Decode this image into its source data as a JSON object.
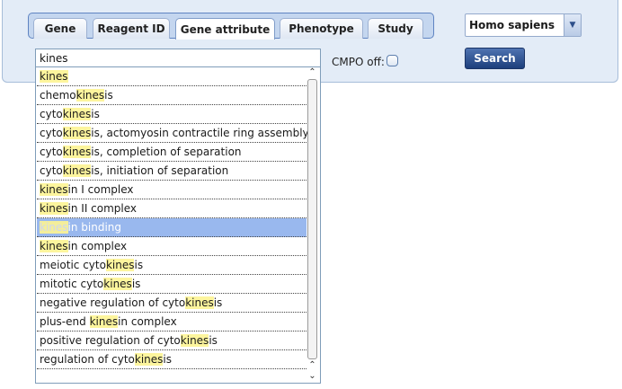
{
  "tabs": [
    {
      "label": "Gene",
      "active": false
    },
    {
      "label": "Reagent ID",
      "active": false
    },
    {
      "label": "Gene attribute",
      "active": true
    },
    {
      "label": "Phenotype",
      "active": false
    },
    {
      "label": "Study",
      "active": false
    }
  ],
  "search": {
    "value": "kines"
  },
  "suggestions": [
    {
      "parts": [
        {
          "t": "kines",
          "h": true
        }
      ]
    },
    {
      "parts": [
        {
          "t": "chemo",
          "h": false
        },
        {
          "t": "kines",
          "h": true
        },
        {
          "t": "is",
          "h": false
        }
      ]
    },
    {
      "parts": [
        {
          "t": "cyto",
          "h": false
        },
        {
          "t": "kines",
          "h": true
        },
        {
          "t": "is",
          "h": false
        }
      ]
    },
    {
      "parts": [
        {
          "t": "cyto",
          "h": false
        },
        {
          "t": "kines",
          "h": true
        },
        {
          "t": "is, actomyosin contractile ring assembly",
          "h": false
        }
      ]
    },
    {
      "parts": [
        {
          "t": "cyto",
          "h": false
        },
        {
          "t": "kines",
          "h": true
        },
        {
          "t": "is, completion of separation",
          "h": false
        }
      ]
    },
    {
      "parts": [
        {
          "t": "cyto",
          "h": false
        },
        {
          "t": "kines",
          "h": true
        },
        {
          "t": "is, initiation of separation",
          "h": false
        }
      ]
    },
    {
      "parts": [
        {
          "t": "kines",
          "h": true
        },
        {
          "t": "in I complex",
          "h": false
        }
      ]
    },
    {
      "parts": [
        {
          "t": "kines",
          "h": true
        },
        {
          "t": "in II complex",
          "h": false
        }
      ]
    },
    {
      "parts": [
        {
          "t": "kines",
          "h": true
        },
        {
          "t": "in binding",
          "h": false
        }
      ],
      "selected": true
    },
    {
      "parts": [
        {
          "t": "kines",
          "h": true
        },
        {
          "t": "in complex",
          "h": false
        }
      ]
    },
    {
      "parts": [
        {
          "t": "meiotic cyto",
          "h": false
        },
        {
          "t": "kines",
          "h": true
        },
        {
          "t": "is",
          "h": false
        }
      ]
    },
    {
      "parts": [
        {
          "t": "mitotic cyto",
          "h": false
        },
        {
          "t": "kines",
          "h": true
        },
        {
          "t": "is",
          "h": false
        }
      ]
    },
    {
      "parts": [
        {
          "t": "negative regulation of cyto",
          "h": false
        },
        {
          "t": "kines",
          "h": true
        },
        {
          "t": "is",
          "h": false
        }
      ]
    },
    {
      "parts": [
        {
          "t": "plus-end ",
          "h": false
        },
        {
          "t": "kines",
          "h": true
        },
        {
          "t": "in complex",
          "h": false
        }
      ]
    },
    {
      "parts": [
        {
          "t": "positive regulation of cyto",
          "h": false
        },
        {
          "t": "kines",
          "h": true
        },
        {
          "t": "is",
          "h": false
        }
      ]
    },
    {
      "parts": [
        {
          "t": "regulation of cyto",
          "h": false
        },
        {
          "t": "kines",
          "h": true
        },
        {
          "t": "is",
          "h": false
        }
      ]
    }
  ],
  "cmpo": {
    "label": "CMPO off:",
    "checked": false
  },
  "species": {
    "value": "Homo sapiens",
    "arrow_icon": "chevron-down-icon"
  },
  "search_button": {
    "label": "Search"
  },
  "colors": {
    "accent": "#1d3f7c",
    "highlight": "#fdf59d",
    "selected": "#99b8ee",
    "panel": "#e3ecf7"
  }
}
